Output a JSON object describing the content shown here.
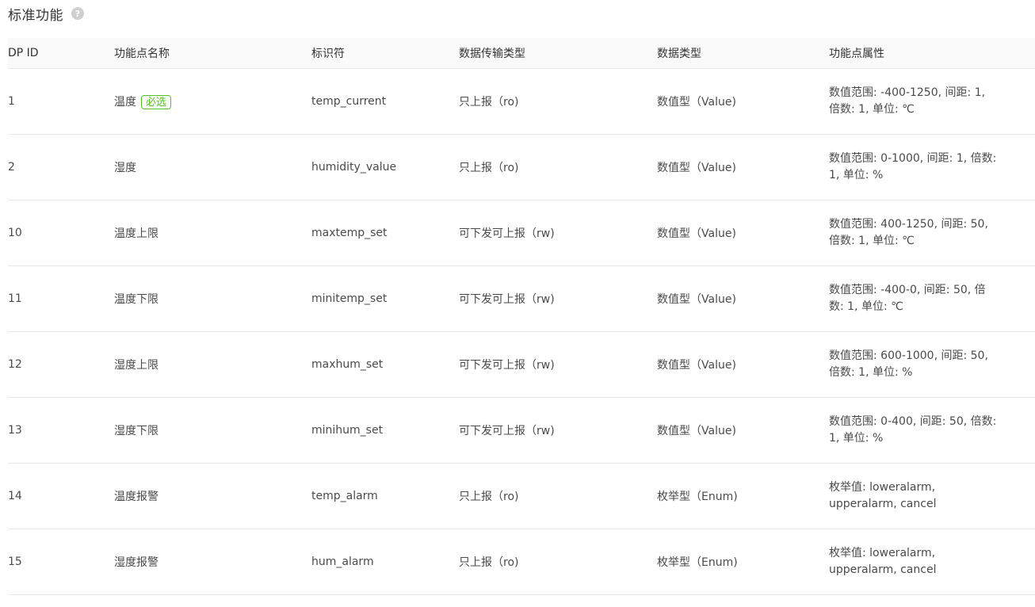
{
  "section": {
    "title": "标准功能",
    "help_icon": "question-circle-icon"
  },
  "table": {
    "columns": [
      "DP ID",
      "功能点名称",
      "标识符",
      "数据传输类型",
      "数据类型",
      "功能点属性"
    ],
    "required_tag": "必选",
    "rows": [
      {
        "dp_id": "1",
        "name": "温度",
        "required": true,
        "identifier": "temp_current",
        "transfer": "只上报（ro)",
        "data_type": "数值型（Value)",
        "attr_line1": "数值范围: -400-1250, 间距: 1,",
        "attr_line2": "倍数: 1, 单位: ℃"
      },
      {
        "dp_id": "2",
        "name": "湿度",
        "required": false,
        "identifier": "humidity_value",
        "transfer": "只上报（ro)",
        "data_type": "数值型（Value)",
        "attr_line1": "数值范围: 0-1000, 间距: 1, 倍数:",
        "attr_line2": "1, 单位: %"
      },
      {
        "dp_id": "10",
        "name": "温度上限",
        "required": false,
        "identifier": "maxtemp_set",
        "transfer": "可下发可上报（rw)",
        "data_type": "数值型（Value)",
        "attr_line1": "数值范围: 400-1250, 间距: 50,",
        "attr_line2": "倍数: 1, 单位: ℃"
      },
      {
        "dp_id": "11",
        "name": "温度下限",
        "required": false,
        "identifier": "minitemp_set",
        "transfer": "可下发可上报（rw)",
        "data_type": "数值型（Value)",
        "attr_line1": "数值范围: -400-0, 间距: 50, 倍",
        "attr_line2": "数: 1, 单位: ℃"
      },
      {
        "dp_id": "12",
        "name": "湿度上限",
        "required": false,
        "identifier": "maxhum_set",
        "transfer": "可下发可上报（rw)",
        "data_type": "数值型（Value)",
        "attr_line1": "数值范围: 600-1000, 间距: 50,",
        "attr_line2": "倍数: 1, 单位: %"
      },
      {
        "dp_id": "13",
        "name": "湿度下限",
        "required": false,
        "identifier": "minihum_set",
        "transfer": "可下发可上报（rw)",
        "data_type": "数值型（Value)",
        "attr_line1": "数值范围: 0-400, 间距: 50, 倍数:",
        "attr_line2": "1, 单位: %"
      },
      {
        "dp_id": "14",
        "name": "温度报警",
        "required": false,
        "identifier": "temp_alarm",
        "transfer": "只上报（ro)",
        "data_type": "枚举型（Enum)",
        "attr_line1": "枚举值: loweralarm,",
        "attr_line2": "upperalarm, cancel"
      },
      {
        "dp_id": "15",
        "name": "湿度报警",
        "required": false,
        "identifier": "hum_alarm",
        "transfer": "只上报（ro)",
        "data_type": "枚举型（Enum)",
        "attr_line1": "枚举值: loweralarm,",
        "attr_line2": "upperalarm, cancel"
      }
    ]
  }
}
